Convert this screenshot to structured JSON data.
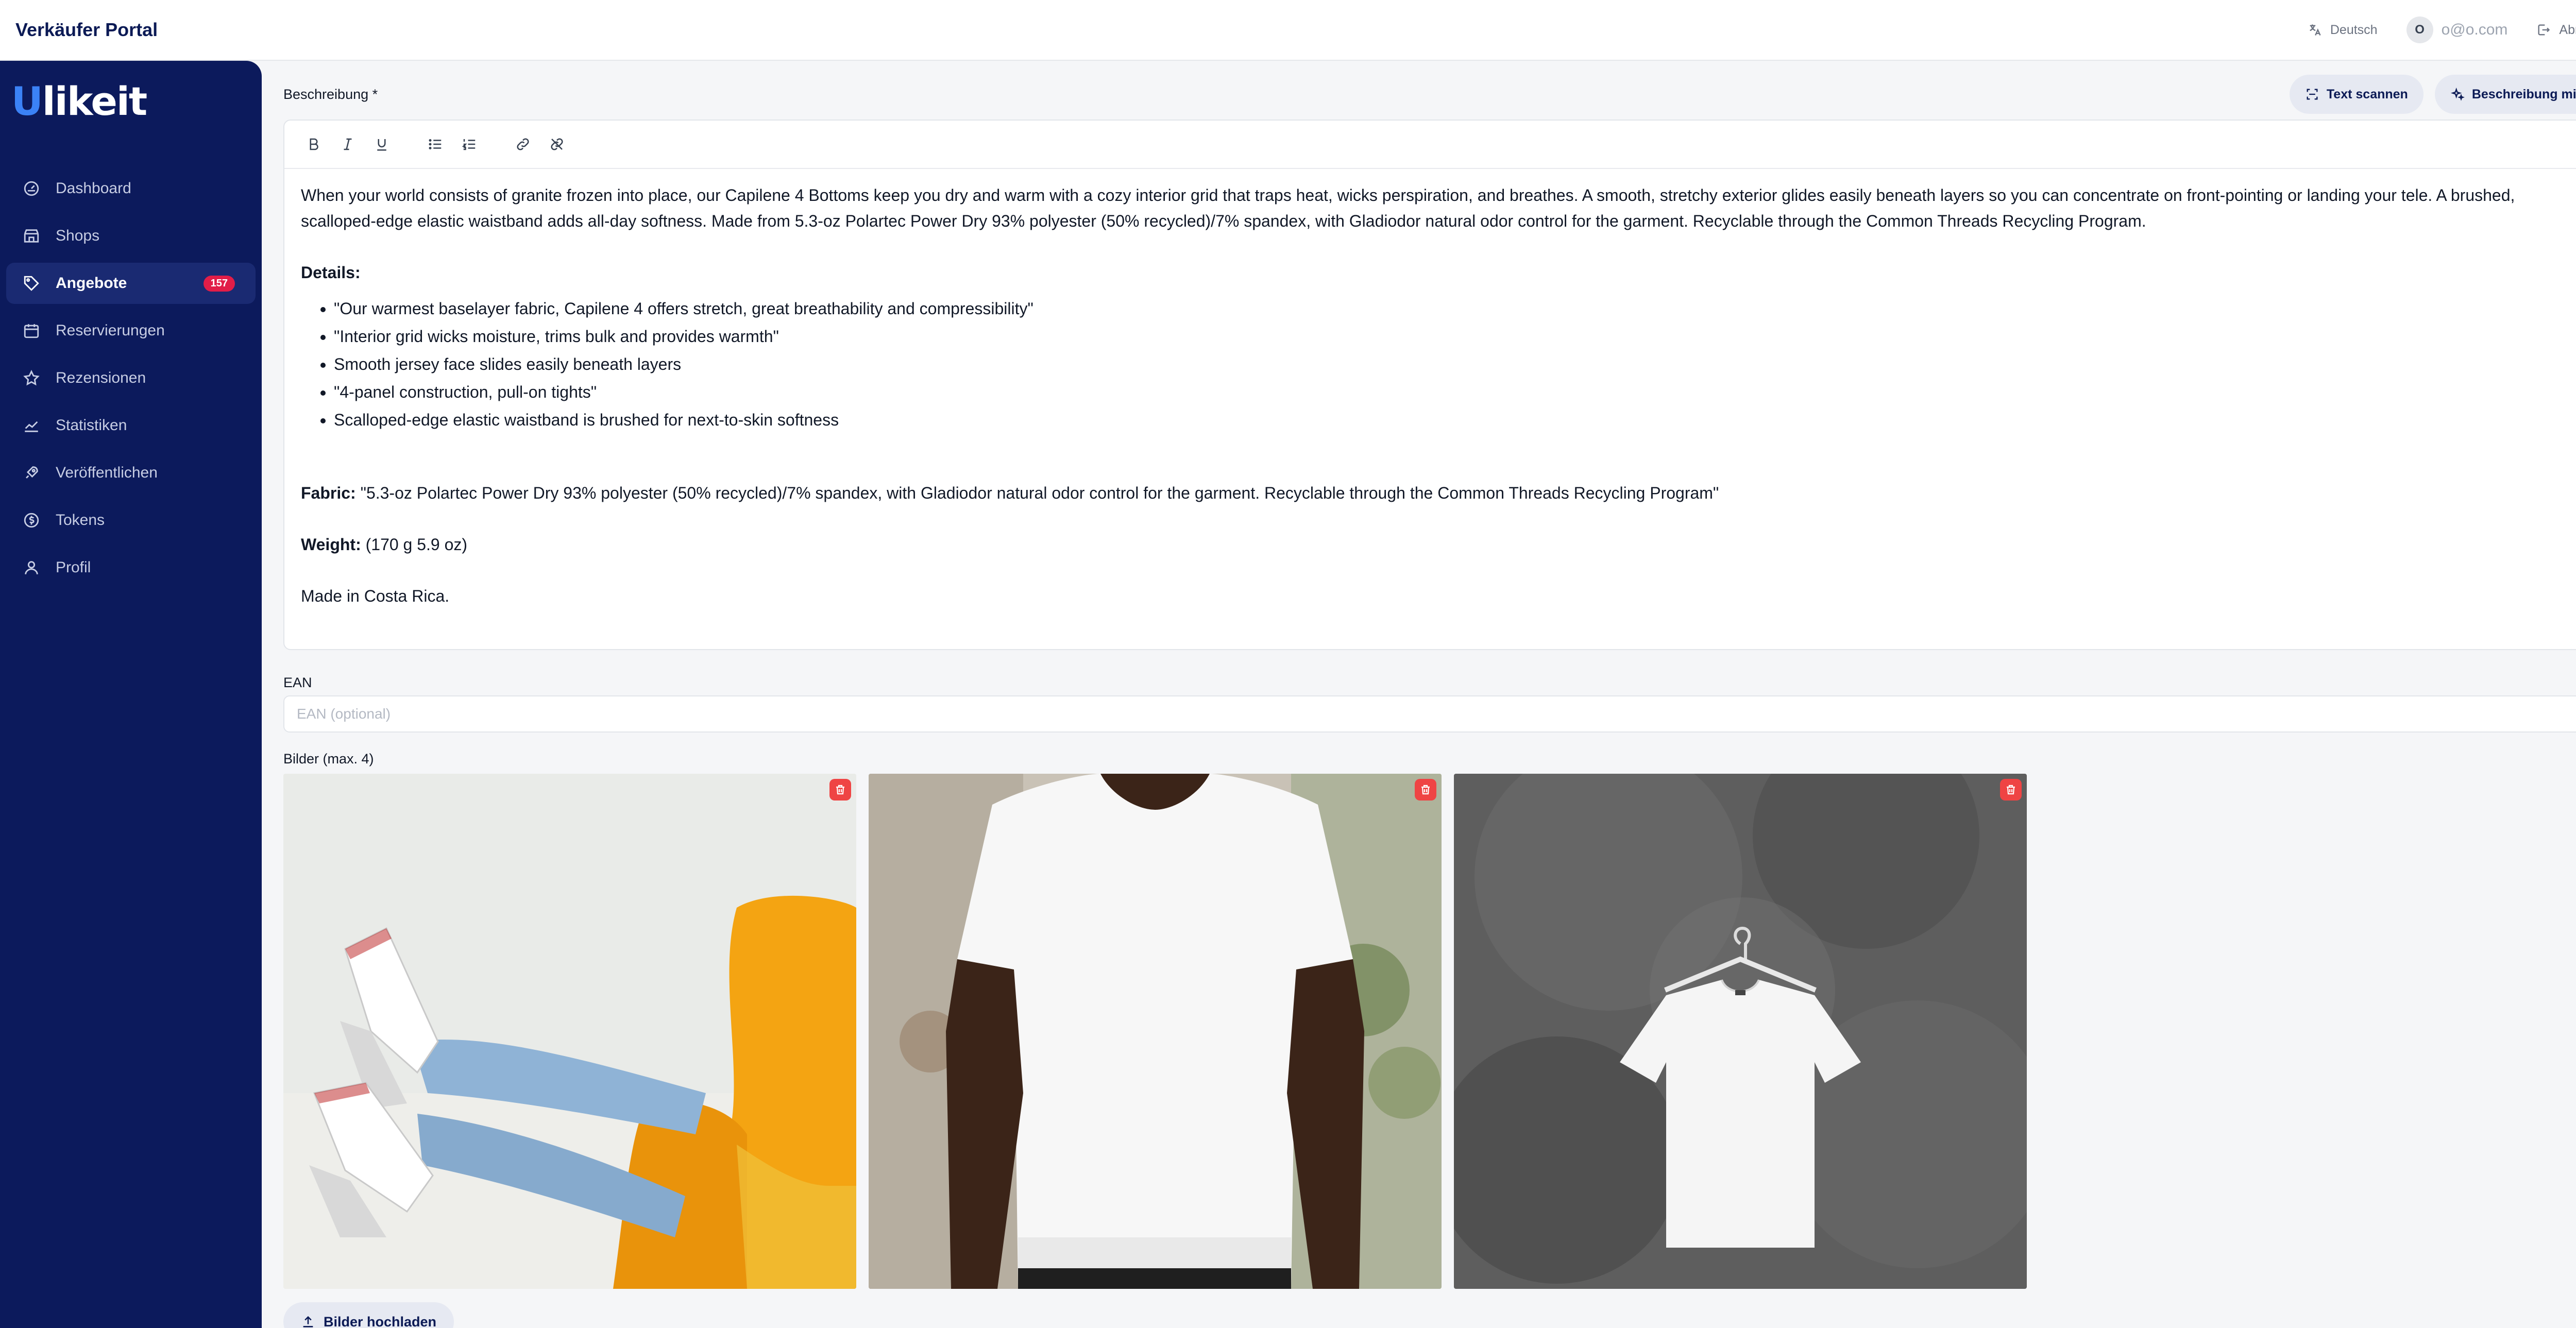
{
  "app": {
    "title": "Verkäufer Portal"
  },
  "topbar": {
    "language": "Deutsch",
    "avatar_initial": "O",
    "email": "o@o.com",
    "logout": "Abmelden"
  },
  "brand": {
    "logo_prefix": "U",
    "logo_rest": "likeit"
  },
  "sidebar": {
    "items": [
      {
        "label": "Dashboard",
        "icon": "gauge-icon"
      },
      {
        "label": "Shops",
        "icon": "store-icon"
      },
      {
        "label": "Angebote",
        "icon": "tag-icon",
        "badge": "157",
        "active": true
      },
      {
        "label": "Reservierungen",
        "icon": "calendar-icon"
      },
      {
        "label": "Rezensionen",
        "icon": "star-icon"
      },
      {
        "label": "Statistiken",
        "icon": "chart-line-icon"
      },
      {
        "label": "Veröffentlichen",
        "icon": "rocket-icon"
      },
      {
        "label": "Tokens",
        "icon": "coin-icon"
      },
      {
        "label": "Profil",
        "icon": "user-icon"
      }
    ]
  },
  "description": {
    "label": "Beschreibung *",
    "scan_button": "Text scannen",
    "ai_button": "Beschreibung mit AI",
    "intro": "When your world consists of granite frozen into place, our Capilene 4 Bottoms keep you dry and warm with a cozy interior grid that traps heat, wicks perspiration, and breathes. A smooth, stretchy exterior glides easily beneath layers so you can concentrate on front-pointing or landing your tele. A brushed, scalloped-edge elastic waistband adds all-day softness. Made from 5.3-oz Polartec Power Dry 93% polyester (50% recycled)/7% spandex, with Gladiodor natural odor control for the garment. Recyclable through the Common Threads Recycling Program.",
    "details_heading": "Details:",
    "details": [
      "\"Our warmest baselayer fabric, Capilene 4 offers stretch, great breathability and compressibility\"",
      "\"Interior grid wicks moisture, trims bulk and provides warmth\"",
      "Smooth jersey face slides easily beneath layers",
      "\"4-panel construction, pull-on tights\"",
      "Scalloped-edge elastic waistband is brushed for next-to-skin softness"
    ],
    "fabric_label": "Fabric:",
    "fabric_text": " \"5.3-oz Polartec Power Dry 93% polyester (50% recycled)/7% spandex, with Gladiodor natural odor control for the garment. Recyclable through the Common Threads Recycling Program\"",
    "weight_label": "Weight:",
    "weight_text": " (170 g 5.9 oz)",
    "origin": "Made in Costa Rica."
  },
  "ean": {
    "label": "EAN",
    "placeholder": "EAN (optional)"
  },
  "images": {
    "label": "Bilder (max. 4)",
    "upload_button": "Bilder hochladen",
    "items": [
      {
        "subject": "sneakers-jeans-yellow-chair"
      },
      {
        "subject": "white-tshirt-worn"
      },
      {
        "subject": "white-tshirt-hanger-concrete"
      }
    ]
  },
  "colors": {
    "sidebar": "#0c1a5c",
    "accent": "#3b82f6",
    "badge": "#e11d48",
    "delete": "#ef4444"
  }
}
